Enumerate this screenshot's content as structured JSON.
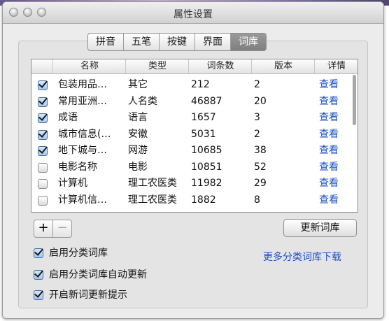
{
  "window": {
    "title": "属性设置"
  },
  "tabs": [
    {
      "label": "拼音",
      "active": false
    },
    {
      "label": "五笔",
      "active": false
    },
    {
      "label": "按键",
      "active": false
    },
    {
      "label": "界面",
      "active": false
    },
    {
      "label": "词库",
      "active": true
    }
  ],
  "table": {
    "headers": [
      "名称",
      "类型",
      "词条数",
      "版本",
      "详情"
    ],
    "rows": [
      {
        "checked": true,
        "name": "包装用品…",
        "type": "其它",
        "count": "212",
        "version": "2",
        "detail": "查看"
      },
      {
        "checked": true,
        "name": "常用亚洲…",
        "type": "人名类",
        "count": "46887",
        "version": "20",
        "detail": "查看"
      },
      {
        "checked": true,
        "name": "成语",
        "type": "语言",
        "count": "1657",
        "version": "3",
        "detail": "查看"
      },
      {
        "checked": true,
        "name": "城市信息(…",
        "type": "安徽",
        "count": "5031",
        "version": "2",
        "detail": "查看"
      },
      {
        "checked": true,
        "name": "地下城与…",
        "type": "网游",
        "count": "10685",
        "version": "38",
        "detail": "查看"
      },
      {
        "checked": false,
        "name": "电影名称",
        "type": "电影",
        "count": "10851",
        "version": "52",
        "detail": "查看"
      },
      {
        "checked": false,
        "name": "计算机",
        "type": "理工农医类",
        "count": "11982",
        "version": "29",
        "detail": "查看"
      },
      {
        "checked": false,
        "name": "计算机信…",
        "type": "理工农医类",
        "count": "1882",
        "version": "8",
        "detail": "查看"
      }
    ]
  },
  "buttons": {
    "add": "+",
    "remove": "−",
    "update": "更新词库"
  },
  "options": [
    {
      "label": "启用分类词库",
      "checked": true
    },
    {
      "label": "启用分类词库自动更新",
      "checked": true
    },
    {
      "label": "开启新词更新提示",
      "checked": true
    }
  ],
  "links": {
    "more": "更多分类词库下载"
  },
  "colors": {
    "link": "#1a4fc8",
    "active_tab": "#8a8a8a",
    "check_accent": "#a9c7ea"
  }
}
